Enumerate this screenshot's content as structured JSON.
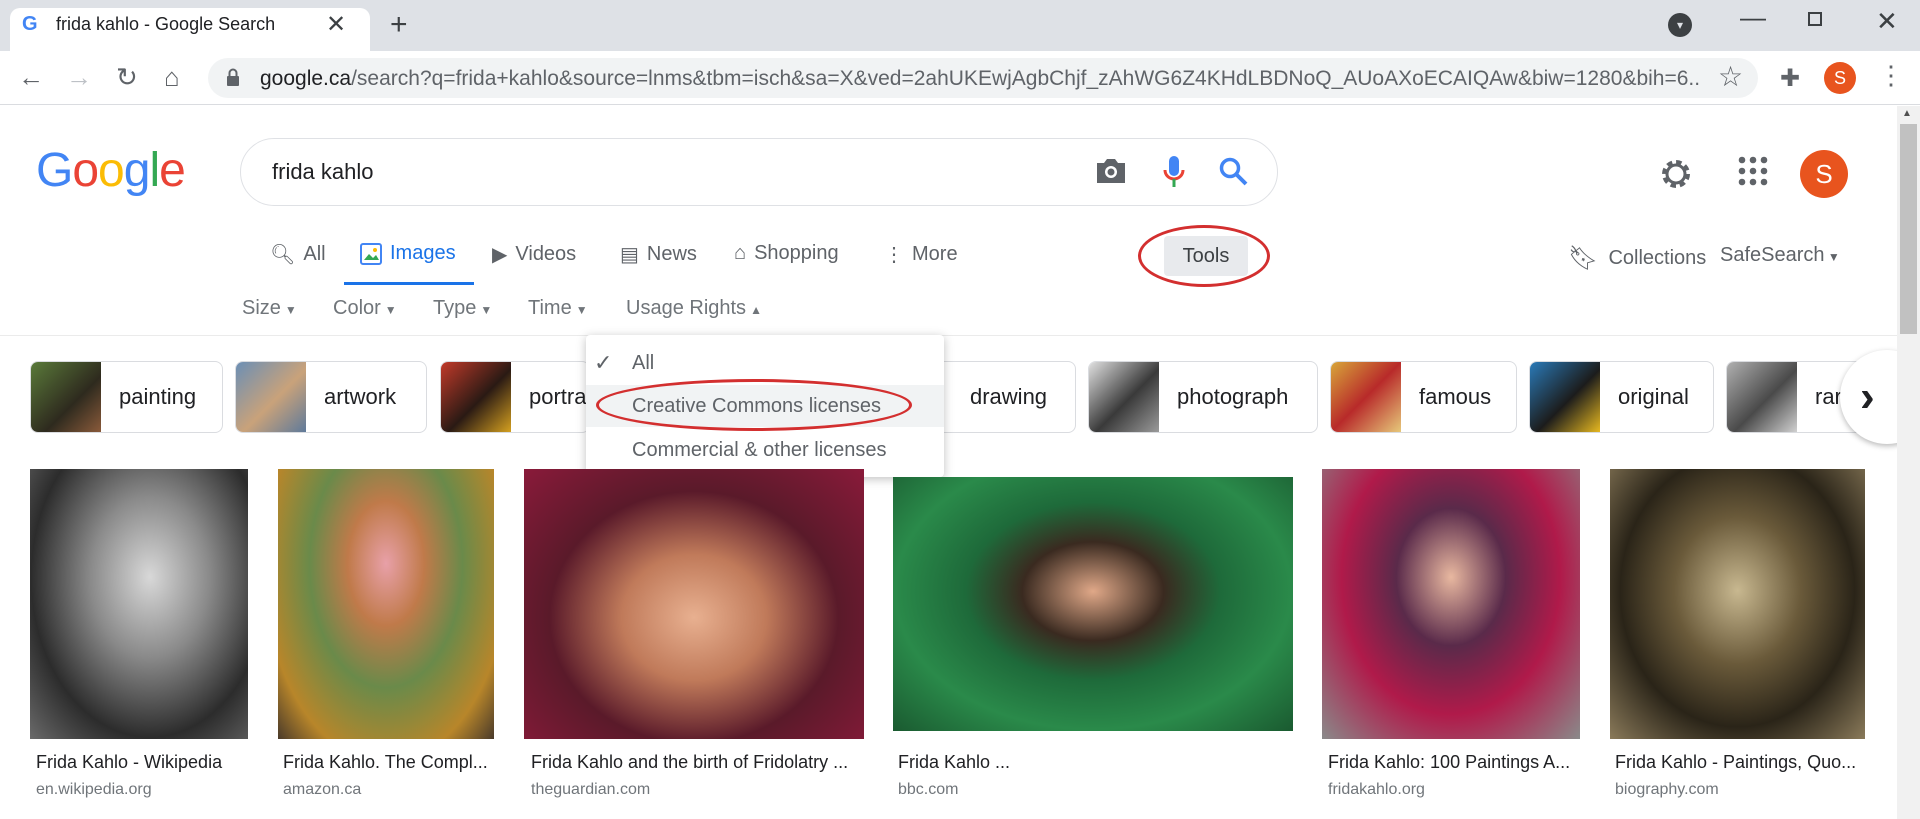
{
  "browser": {
    "tab_title": "frida kahlo - Google Search",
    "tab_favicon": "G",
    "url_host": "google.ca",
    "url_path": "/search?q=frida+kahlo&source=lnms&tbm=isch&sa=X&ved=2ahUKEwjAgbChjf_zAhWG6Z4KHdLBDNoQ_AUoAXoECAIQAw&biw=1280&bih=6...",
    "profile_initial": "S"
  },
  "google": {
    "logo_letters": [
      "G",
      "o",
      "o",
      "g",
      "l",
      "e"
    ],
    "logo_colors": [
      "#4285f4",
      "#ea4335",
      "#fbbc05",
      "#4285f4",
      "#34a853",
      "#ea4335"
    ],
    "query": "frida kahlo",
    "account_initial": "S"
  },
  "tabs": {
    "all": "All",
    "images": "Images",
    "videos": "Videos",
    "news": "News",
    "shopping": "Shopping",
    "more": "More",
    "tools": "Tools",
    "collections": "Collections",
    "safesearch": "SafeSearch"
  },
  "filters": {
    "size": "Size",
    "color": "Color",
    "type": "Type",
    "time": "Time",
    "usage_rights": "Usage Rights"
  },
  "usage_menu": {
    "items": [
      "All",
      "Creative Commons licenses",
      "Commercial & other licenses"
    ],
    "selected": "All",
    "highlighted": "Creative Commons licenses"
  },
  "chips": [
    "painting",
    "artwork",
    "portrait",
    "drawing",
    "photograph",
    "famous",
    "original",
    "rare"
  ],
  "chip_visible": {
    "portrait": "portra",
    "rare": "rar"
  },
  "results": [
    {
      "title": "Frida Kahlo - Wikipedia",
      "source": "en.wikipedia.org"
    },
    {
      "title": "Frida Kahlo. The Compl...",
      "source": "amazon.ca"
    },
    {
      "title": "Frida Kahlo and the birth of Fridolatry ...",
      "source": "theguardian.com"
    },
    {
      "title": "Frida Kahlo ...",
      "source": "bbc.com"
    },
    {
      "title": "Frida Kahlo: 100 Paintings A...",
      "source": "fridakahlo.org"
    },
    {
      "title": "Frida Kahlo - Paintings, Quo...",
      "source": "biography.com"
    }
  ],
  "icons": {
    "camera": "camera-icon",
    "mic": "mic-icon",
    "search": "search-icon",
    "settings": "gear-icon",
    "apps": "apps-grid-icon"
  },
  "annotation_color": "#d32f2f"
}
